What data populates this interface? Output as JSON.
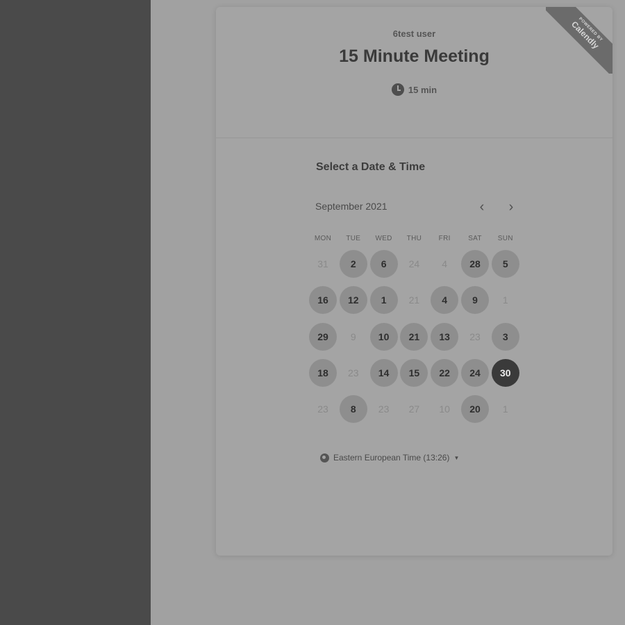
{
  "header": {
    "host_name": "6test user",
    "event_title": "15 Minute Meeting",
    "duration": "15 min"
  },
  "ribbon": {
    "powered_by": "POWERED BY",
    "brand": "Calendly"
  },
  "calendar": {
    "section_title": "Select a Date & Time",
    "month_label": "September 2021",
    "prev_icon": "chevron-left-icon",
    "next_icon": "chevron-right-icon",
    "weekdays": [
      "MON",
      "TUE",
      "WED",
      "THU",
      "FRI",
      "SAT",
      "SUN"
    ],
    "weeks": [
      [
        {
          "label": "31",
          "state": "unavailable"
        },
        {
          "label": "2",
          "state": "available"
        },
        {
          "label": "6",
          "state": "available"
        },
        {
          "label": "24",
          "state": "unavailable"
        },
        {
          "label": "4",
          "state": "unavailable"
        },
        {
          "label": "28",
          "state": "available"
        },
        {
          "label": "5",
          "state": "available"
        }
      ],
      [
        {
          "label": "16",
          "state": "available"
        },
        {
          "label": "12",
          "state": "available"
        },
        {
          "label": "1",
          "state": "available"
        },
        {
          "label": "21",
          "state": "unavailable"
        },
        {
          "label": "4",
          "state": "available"
        },
        {
          "label": "9",
          "state": "available"
        },
        {
          "label": "1",
          "state": "unavailable"
        }
      ],
      [
        {
          "label": "29",
          "state": "available"
        },
        {
          "label": "9",
          "state": "unavailable"
        },
        {
          "label": "10",
          "state": "available"
        },
        {
          "label": "21",
          "state": "available"
        },
        {
          "label": "13",
          "state": "available"
        },
        {
          "label": "23",
          "state": "unavailable"
        },
        {
          "label": "3",
          "state": "available"
        }
      ],
      [
        {
          "label": "18",
          "state": "available"
        },
        {
          "label": "23",
          "state": "unavailable"
        },
        {
          "label": "14",
          "state": "available"
        },
        {
          "label": "15",
          "state": "available"
        },
        {
          "label": "22",
          "state": "available"
        },
        {
          "label": "24",
          "state": "available"
        },
        {
          "label": "30",
          "state": "selected"
        }
      ],
      [
        {
          "label": "23",
          "state": "unavailable"
        },
        {
          "label": "8",
          "state": "available"
        },
        {
          "label": "23",
          "state": "unavailable"
        },
        {
          "label": "27",
          "state": "unavailable"
        },
        {
          "label": "10",
          "state": "unavailable"
        },
        {
          "label": "20",
          "state": "available"
        },
        {
          "label": "1",
          "state": "unavailable"
        }
      ]
    ]
  },
  "timezone": {
    "label": "Eastern European Time (13:26)",
    "icon": "globe-icon"
  }
}
